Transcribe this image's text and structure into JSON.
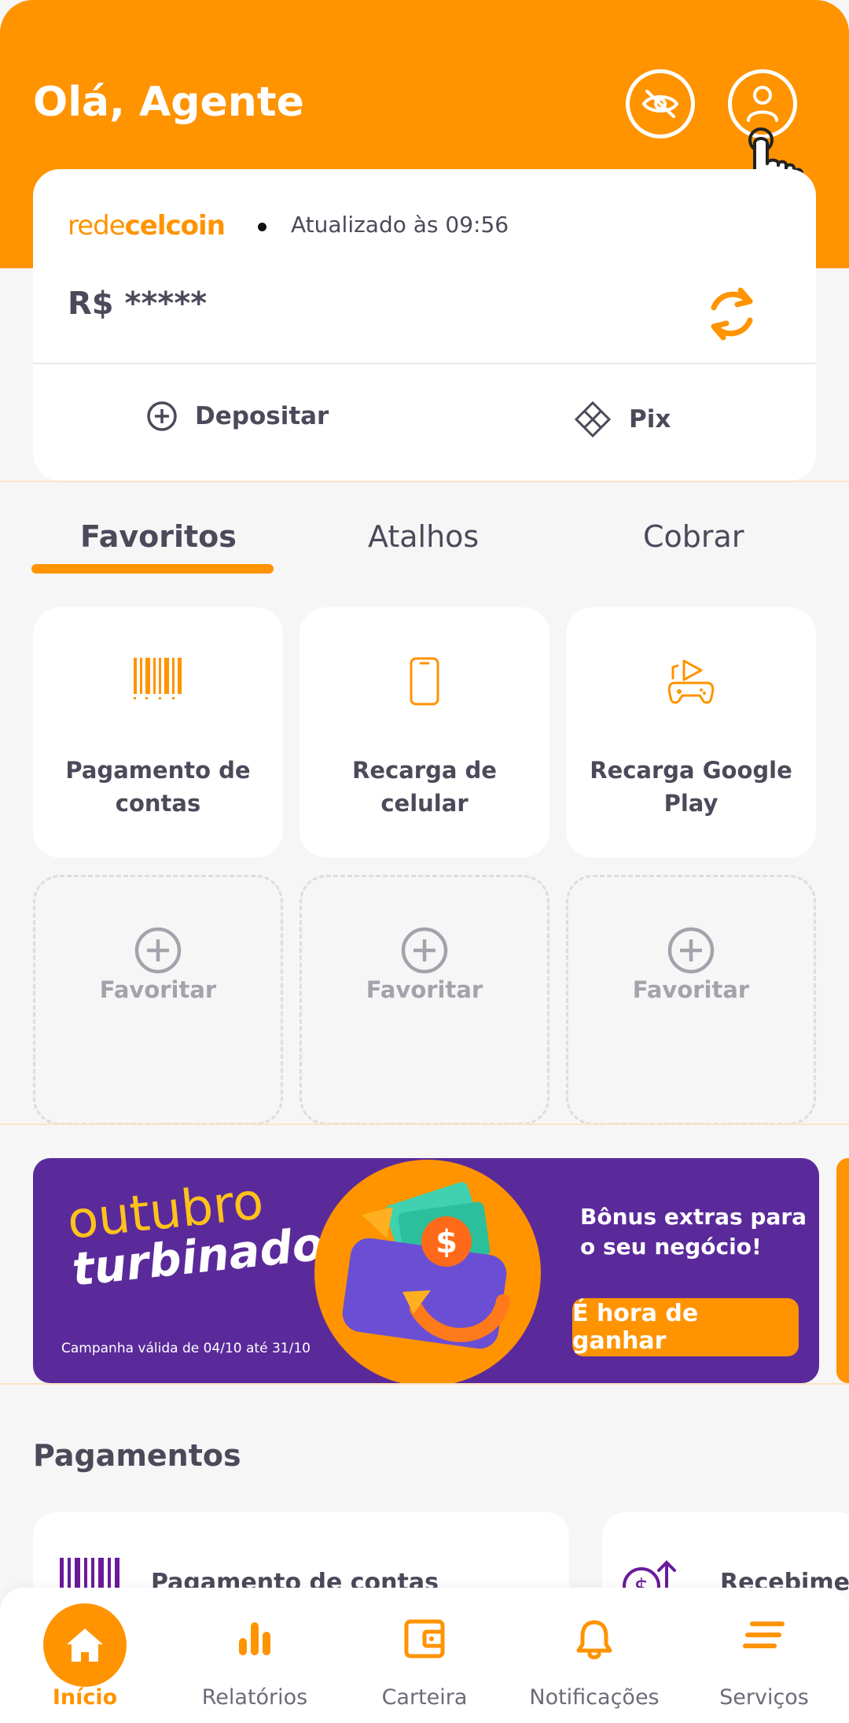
{
  "header": {
    "greeting": "Olá, Agente",
    "icons": [
      "eye-off-icon",
      "user-icon"
    ]
  },
  "balance": {
    "brand_part1": "rede",
    "brand_part2": "celcoin",
    "updated": "Atualizado às 09:56",
    "amount": "R$ *****",
    "actions": {
      "deposit": "Depositar",
      "pix": "Pix"
    }
  },
  "tabs": [
    {
      "label": "Favoritos",
      "active": true
    },
    {
      "label": "Atalhos",
      "active": false
    },
    {
      "label": "Cobrar",
      "active": false
    }
  ],
  "favorites": [
    {
      "label": "Pagamento de contas",
      "icon": "barcode-icon"
    },
    {
      "label": "Recarga de celular",
      "icon": "phone-icon"
    },
    {
      "label": "Recarga Google Play",
      "icon": "gamepad-icon"
    },
    {
      "label": "Favoritar",
      "icon": "plus-circle-icon"
    },
    {
      "label": "Favoritar",
      "icon": "plus-circle-icon"
    },
    {
      "label": "Favoritar",
      "icon": "plus-circle-icon"
    }
  ],
  "banner": {
    "title_line1": "outubro",
    "title_line2": "turbinado",
    "validity": "Campanha válida de 04/10 até 31/10",
    "bonus": "Bônus extras para o seu negócio!",
    "cta": "É hora de ganhar"
  },
  "payments": {
    "title": "Pagamentos",
    "cards": [
      "Pagamento de contas",
      "Recebimen"
    ]
  },
  "nav": [
    {
      "label": "Início",
      "icon": "home-icon",
      "active": true
    },
    {
      "label": "Relatórios",
      "icon": "bar-chart-icon",
      "active": false
    },
    {
      "label": "Carteira",
      "icon": "wallet-icon",
      "active": false
    },
    {
      "label": "Notificações",
      "icon": "bell-icon",
      "active": false
    },
    {
      "label": "Serviços",
      "icon": "menu-icon",
      "active": false
    }
  ],
  "colors": {
    "accent": "#ff9300",
    "banner_purple": "#5a2a9a",
    "text": "#4a4a5a"
  }
}
